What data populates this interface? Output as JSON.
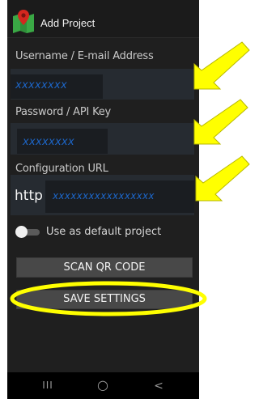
{
  "app": {
    "title": "Add Project",
    "logo_icon": "map-marker-icon"
  },
  "form": {
    "username": {
      "label": "Username / E-mail Address",
      "value": "xxxxxxxx"
    },
    "password": {
      "label": "Password / API Key",
      "value": "xxxxxxxx"
    },
    "config_url": {
      "label": "Configuration URL",
      "prefix": "http",
      "value": "xxxxxxxxxxxxxxxxx"
    }
  },
  "default_project": {
    "label": "Use as default project",
    "enabled": false
  },
  "buttons": {
    "scan_qr": "SCAN QR CODE",
    "save": "SAVE SETTINGS"
  },
  "navbar": {
    "recents": "III",
    "home": "○",
    "back": "<"
  },
  "colors": {
    "annotation_arrows": "#ffff00",
    "annotation_circle": "#ffff00",
    "masked_text": "#1d66c8"
  }
}
